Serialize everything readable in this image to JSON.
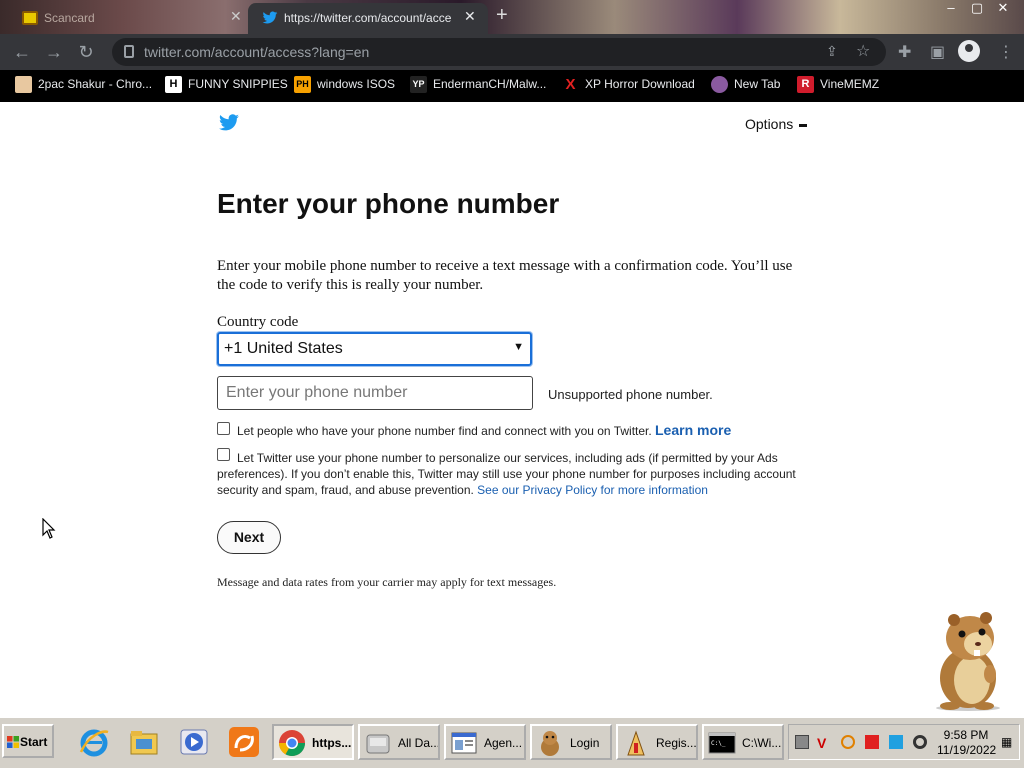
{
  "browser": {
    "tabs": [
      {
        "title": "Scancard"
      },
      {
        "title": "https://twitter.com/account/acce"
      }
    ],
    "url": "twitter.com/account/access?lang=en",
    "window_controls": [
      "–",
      "▢",
      "✕"
    ]
  },
  "bookmarks": [
    {
      "label": "2pac Shakur - Chro...",
      "icon_name": "chrome-icon",
      "icon_text": "",
      "color": "#e8c8a0"
    },
    {
      "label": "FUNNY SNIPPIES",
      "icon_name": "h-icon",
      "icon_text": "H",
      "color": "#ffffff"
    },
    {
      "label": "windows ISOS",
      "icon_name": "ph-icon",
      "icon_text": "PH",
      "color": "#f7a100"
    },
    {
      "label": "EndermanCH/Malw...",
      "icon_name": "yp-icon",
      "icon_text": "YP",
      "color": "#222222"
    },
    {
      "label": "XP Horror Download",
      "icon_name": "x-icon",
      "icon_text": "X",
      "color": "#e02020"
    },
    {
      "label": "New Tab",
      "icon_name": "globe-icon",
      "icon_text": "",
      "color": "#8a5aa0"
    },
    {
      "label": "VineMEMZ",
      "icon_name": "r-icon",
      "icon_text": "R",
      "color": "#d01c2c"
    }
  ],
  "page": {
    "options_label": "Options",
    "heading": "Enter your phone number",
    "intro": "Enter your mobile phone number to receive a text message with a confirmation code. You’ll use the code to verify this is really your number.",
    "country_code_label": "Country code",
    "country_code_value": "+1 United States",
    "phone_placeholder": "Enter your phone number",
    "phone_error": "Unsupported phone number.",
    "checkbox1_text": "Let people who have your phone number find and connect with you on Twitter.",
    "learn_more": "Learn more",
    "checkbox2_text": "Let Twitter use your phone number to personalize our services, including ads (if permitted by your Ads preferences). If you don’t enable this, Twitter may still use your phone number for purposes including account security and spam, fraud, and abuse prevention.",
    "privacy_link": "See our Privacy Policy for more information",
    "next_label": "Next",
    "footer": "Message and data rates from your carrier may apply for text messages."
  },
  "taskbar": {
    "start_label": "Start",
    "buttons": [
      {
        "label": "https...",
        "icon_name": "chrome-icon"
      },
      {
        "label": "All Da...",
        "icon_name": "drive-icon"
      },
      {
        "label": "Agen...",
        "icon_name": "window-icon"
      },
      {
        "label": "Login",
        "icon_name": "hamster-icon"
      },
      {
        "label": "Regis...",
        "icon_name": "installer-icon"
      },
      {
        "label": "C:\\Wi...",
        "icon_name": "cmd-icon"
      }
    ],
    "clock_time": "9:58 PM",
    "clock_date": "11/19/2022"
  },
  "colors": {
    "twitter_blue": "#1d9bf0",
    "link_blue": "#1a5fb0",
    "chrome_dark": "#35363a"
  }
}
